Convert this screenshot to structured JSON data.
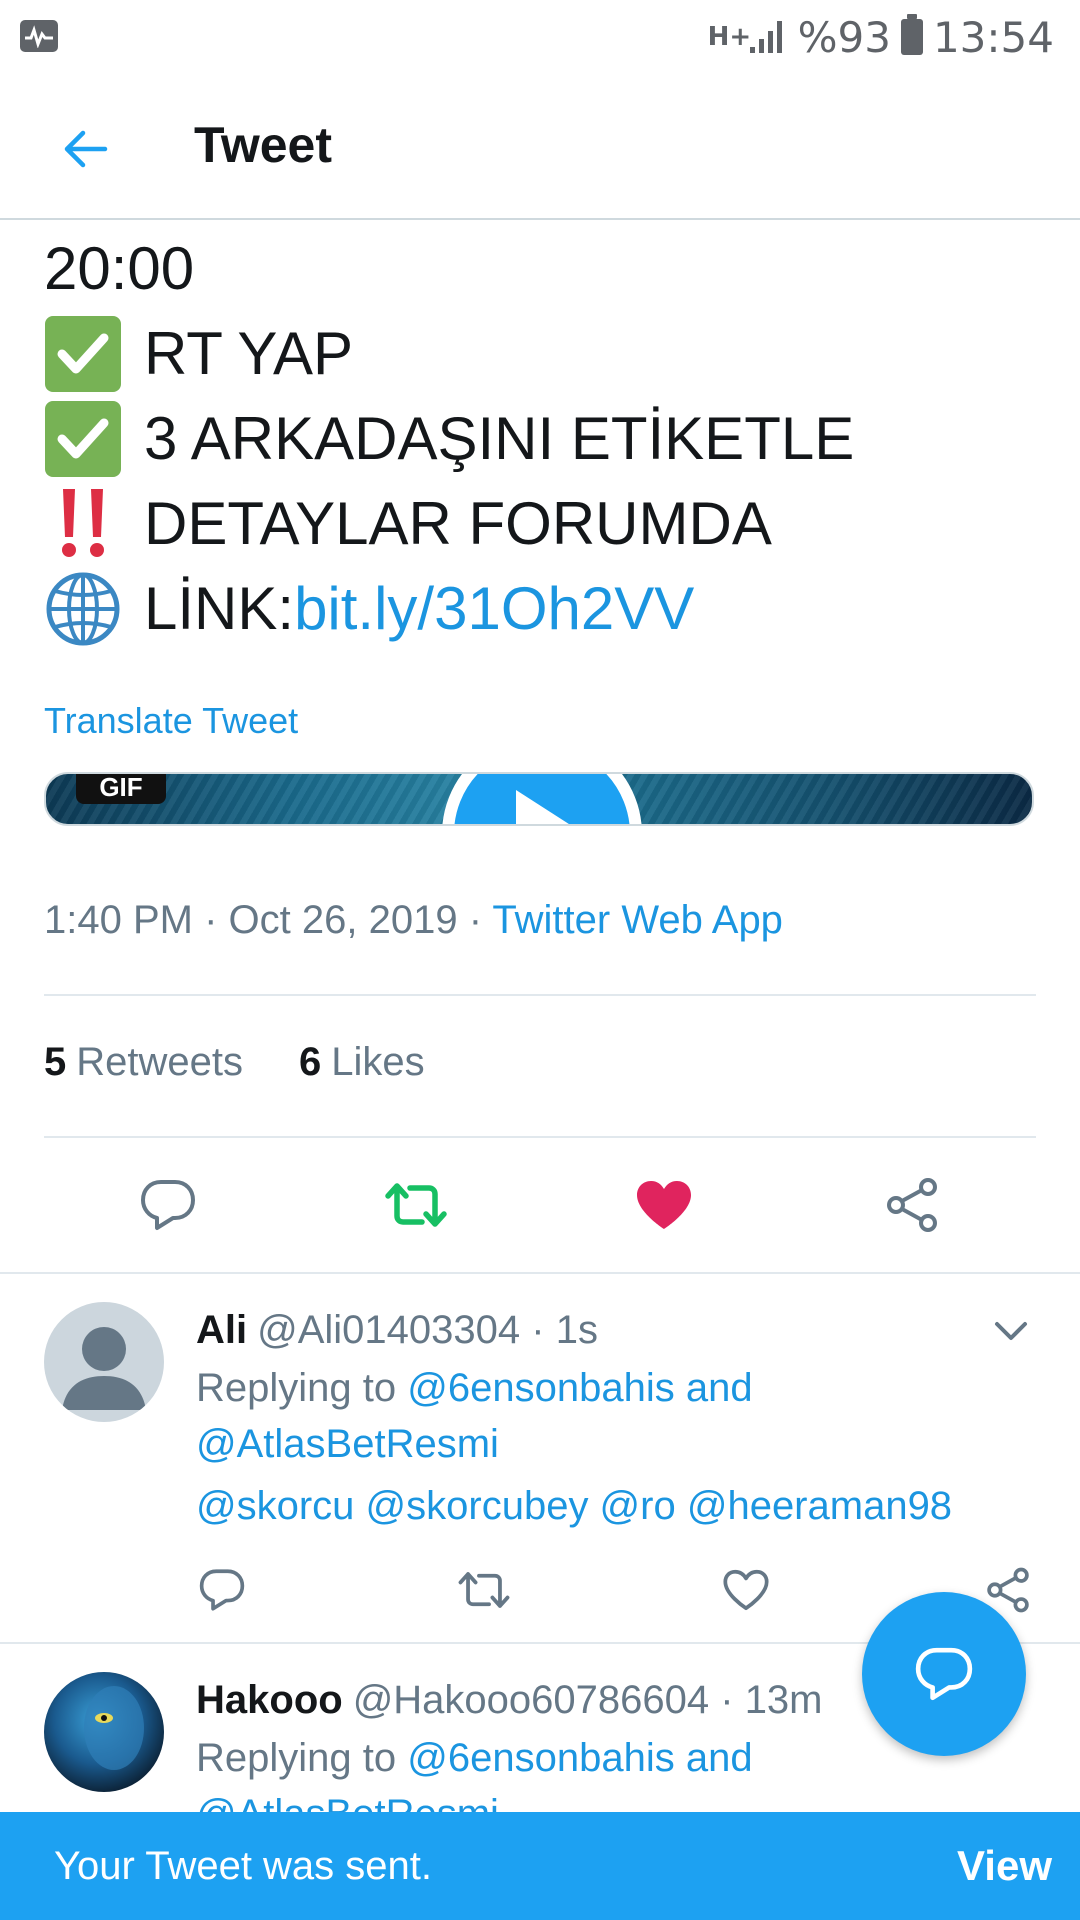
{
  "status_bar": {
    "network_type": "H+",
    "battery": "%93",
    "time": "13:54"
  },
  "header": {
    "title": "Tweet",
    "back_icon": "arrow-left-icon"
  },
  "tweet": {
    "lines": [
      {
        "prefix_emoji": "",
        "text": "20:00"
      },
      {
        "prefix_emoji": "check-mark-icon",
        "text": "RT YAP"
      },
      {
        "prefix_emoji": "check-mark-icon",
        "text": "3 ARKADAŞINI ETİKETLE"
      },
      {
        "prefix_emoji": "double-exclamation-icon",
        "text": "DETAYLAR FORUMDA"
      },
      {
        "prefix_emoji": "globe-icon",
        "text": "LİNK: ",
        "link": "bit.ly/31Oh2VV"
      }
    ],
    "translate_label": "Translate Tweet",
    "media": {
      "badge": "GIF"
    },
    "time": "1:40 PM",
    "date": "Oct 26, 2019",
    "via": "Twitter Web App",
    "retweets_count": "5",
    "retweets_label": "Retweets",
    "likes_count": "6",
    "likes_label": "Likes"
  },
  "replies": [
    {
      "name": "Ali",
      "handle": "@Ali01403304",
      "age": "1s",
      "replying_to_label": "Replying to",
      "replying_to_1": "@6ensonbahis",
      "and_label": "and",
      "replying_to_2": "@AtlasBetResmi",
      "text": "@skorcu @skorcubey @ro @heeraman98"
    },
    {
      "name": "Hakooo",
      "handle": "@Hakooo60786604",
      "age": "13m",
      "replying_to_label": "Replying to",
      "replying_to_1": "@6ensonbahis",
      "and_label": "and",
      "replying_to_2": "@AtlasBetResmi"
    }
  ],
  "snackbar": {
    "message": "Your Tweet was sent.",
    "action": "View"
  },
  "colors": {
    "accent": "#1da1f2",
    "link": "#1b95e0",
    "retweet_active": "#17bf63",
    "like_active": "#e0245e",
    "secondary_text": "#657786"
  }
}
